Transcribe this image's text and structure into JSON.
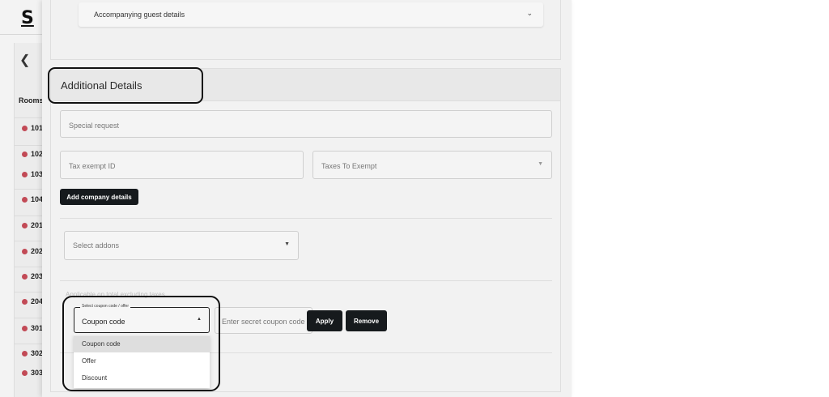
{
  "background": {
    "logo": "S",
    "rooms_heading": "Rooms",
    "rooms": [
      "101",
      "102",
      "103",
      "104",
      "201",
      "202",
      "203",
      "204",
      "301",
      "302",
      "303"
    ]
  },
  "guests": {
    "accordion_label": "Accompanying guest details"
  },
  "additional_details": {
    "title": "Additional Details",
    "special_request_placeholder": "Special request",
    "tax_exempt_id_placeholder": "Tax exempt ID",
    "taxes_to_exempt_placeholder": "Taxes To Exempt",
    "add_company_button": "Add company details",
    "addons_placeholder": "Select addons",
    "coupon_note": "Applicable on total excluding taxes",
    "coupon_select": {
      "legend": "Select coupon code / offer",
      "value": "Coupon code",
      "options": [
        "Coupon code",
        "Offer",
        "Discount"
      ]
    },
    "secret_code_placeholder": "Enter secret coupon code",
    "apply_button": "Apply",
    "remove_button": "Remove"
  },
  "colors": {
    "room_status_dot": "#c24a56",
    "dark_button": "#161a1d",
    "highlight_outline": "#111111"
  }
}
